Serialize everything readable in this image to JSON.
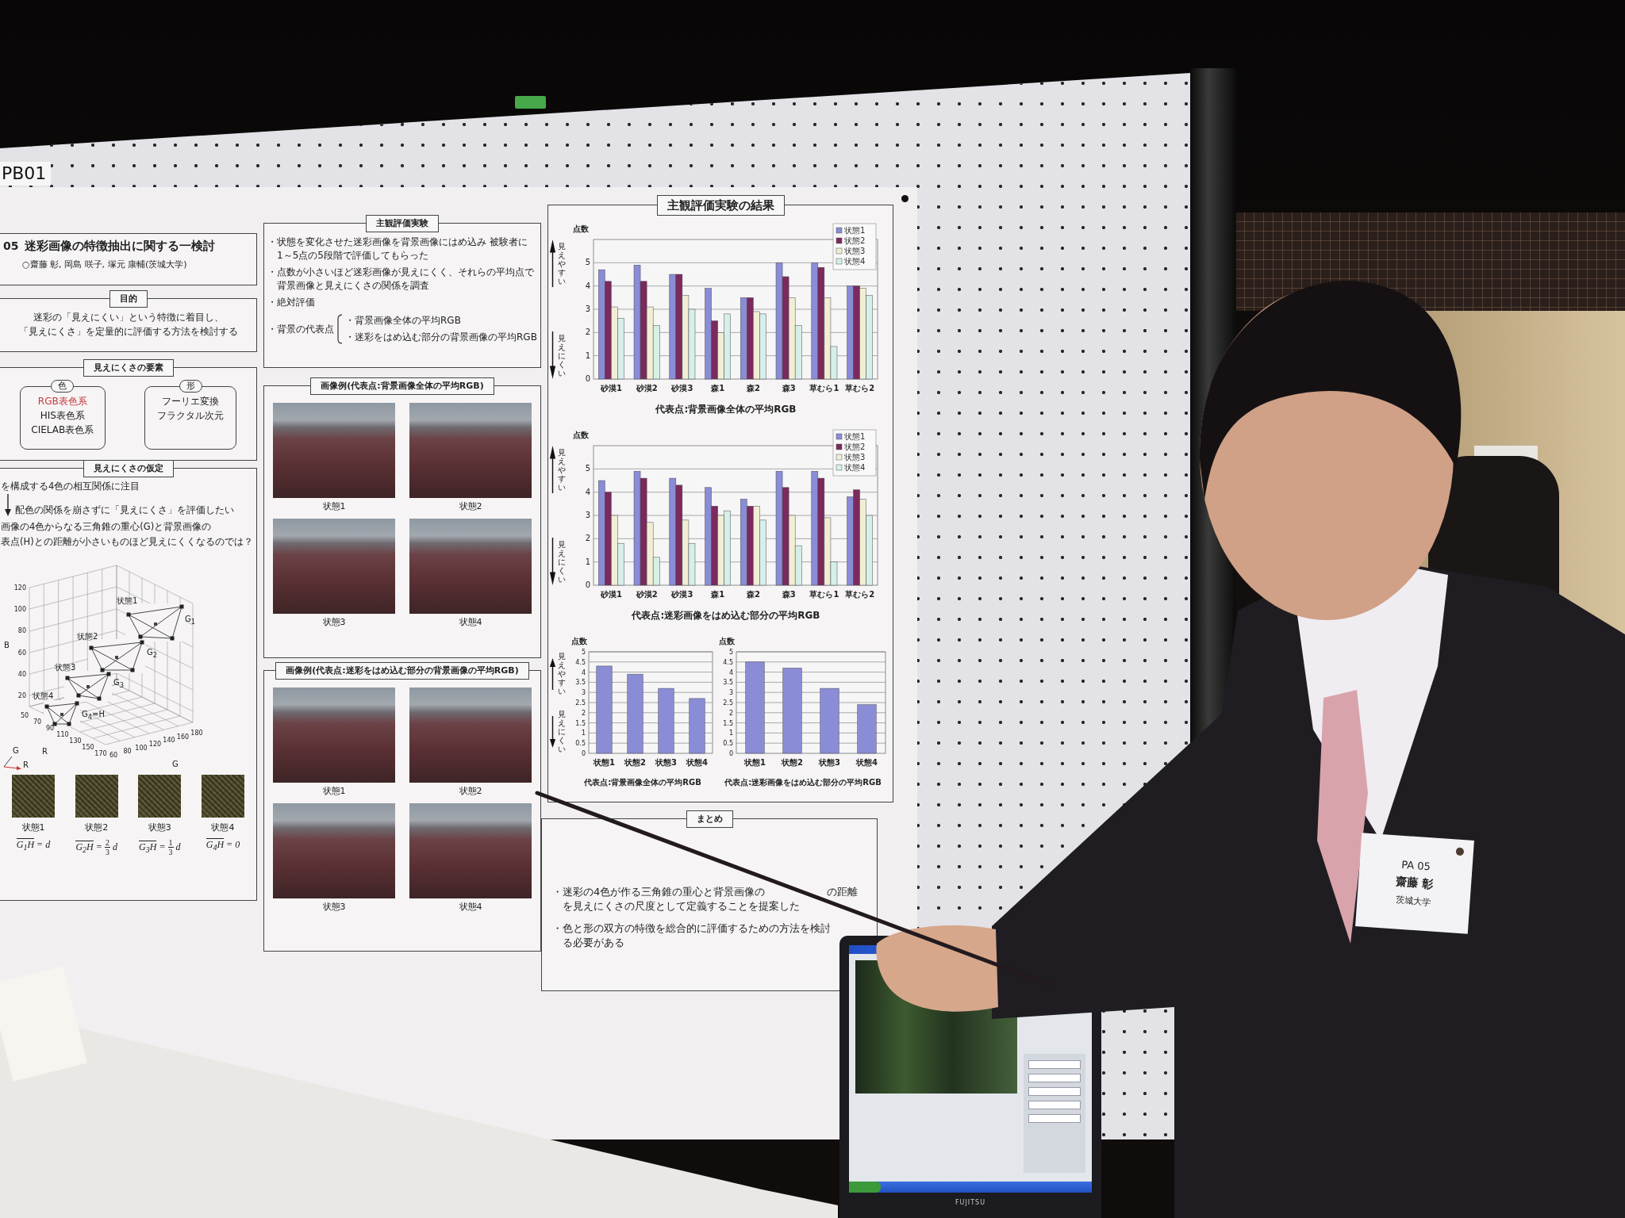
{
  "board_label": "PB01",
  "poster": {
    "title": {
      "number": "05",
      "text": "迷彩画像の特徴抽出に関する一検討",
      "authors": "○齋藤 彰, 岡島 咲子, 塚元 康輔(茨城大学)"
    },
    "purpose": {
      "heading": "目的",
      "text_lines": [
        "迷彩の「見えにくい」という特徴に着目し、",
        "「見えにくさ」を定量的に評価する方法を検討する"
      ]
    },
    "factors": {
      "heading": "見えにくさの要素",
      "groups": [
        {
          "heading": "色",
          "items": [
            {
              "text": "RGB表色系",
              "highlighted": true
            },
            {
              "text": "HIS表色系",
              "highlighted": false
            },
            {
              "text": "CIELAB表色系",
              "highlighted": false
            }
          ]
        },
        {
          "heading": "形",
          "items": [
            {
              "text": "フーリエ変換",
              "highlighted": false
            },
            {
              "text": "フラクタル次元",
              "highlighted": false
            }
          ]
        }
      ]
    },
    "hypothesis": {
      "heading": "見えにくさの仮定",
      "statements": [
        {
          "kind": "text",
          "text": "を構成する4色の相互関係に注目"
        },
        {
          "kind": "arrow",
          "text": "配色の関係を崩さずに「見えにくさ」を評価したい"
        },
        {
          "kind": "text",
          "text": "画像の4色からなる三角錐の重心(G)と背景画像の"
        },
        {
          "kind": "text",
          "text": "表点(H)との距離が小さいものほど見えにくくなるのでは？"
        }
      ],
      "plot": {
        "b_axis": "B",
        "r_axis": "R",
        "g_axis": "G",
        "b_ticks": [
          "120",
          "100",
          "80",
          "60",
          "40",
          "20"
        ],
        "r_ticks": [
          "50",
          "70",
          "90",
          "110",
          "130",
          "150",
          "170"
        ],
        "g_ticks": [
          "60",
          "80",
          "100",
          "120",
          "140",
          "160",
          "180"
        ],
        "groups": [
          {
            "label": "状態1",
            "centroid": "G$_{1}$"
          },
          {
            "label": "状態2",
            "centroid": "G$_{2}$"
          },
          {
            "label": "状態3",
            "centroid": "G$_{3}$"
          },
          {
            "label": "状態4",
            "centroid": "G$_{4}$=H"
          }
        ],
        "orientation": [
          "G",
          "R"
        ]
      },
      "states": [
        {
          "label": "状態1",
          "formula": [
            {
              "kind": "over",
              "text": "G$_{1}$H"
            },
            {
              "kind": "text",
              "text": "= d"
            }
          ]
        },
        {
          "label": "状態2",
          "formula": [
            {
              "kind": "over",
              "text": "G$_{2}$H"
            },
            {
              "kind": "text",
              "text": "="
            },
            {
              "kind": "frac",
              "num": "2",
              "den": "3"
            },
            {
              "kind": "text",
              "text": "d"
            }
          ]
        },
        {
          "label": "状態3",
          "formula": [
            {
              "kind": "over",
              "text": "G$_{3}$H"
            },
            {
              "kind": "text",
              "text": "="
            },
            {
              "kind": "frac",
              "num": "1",
              "den": "3"
            },
            {
              "kind": "text",
              "text": "d"
            }
          ]
        },
        {
          "label": "状態4",
          "formula": [
            {
              "kind": "over",
              "text": "G$_{4}$H"
            },
            {
              "kind": "text",
              "text": "= 0"
            }
          ]
        }
      ]
    },
    "experiment": {
      "heading": "主観評価実験",
      "bullets": [
        {
          "lines": [
            "・状態を変化させた迷彩画像を背景画像にはめ込み 被験者に",
            "1～5点の5段階で評価してもらった"
          ]
        },
        {
          "lines": [
            "・点数が小さいほど迷彩画像が見えにくく、それらの平均点で",
            "背景画像と見えにくさの関係を調査"
          ]
        },
        {
          "lines": [
            "・絶対評価"
          ]
        }
      ],
      "representative": {
        "label": "・背景の代表点",
        "options": [
          "・背景画像全体の平均RGB",
          "・迷彩をはめ込む部分の背景画像の平均RGB"
        ]
      }
    },
    "examples": [
      {
        "heading": "画像例(代表点:背景画像全体の平均RGB)",
        "photos": [
          {
            "caption": "状態1"
          },
          {
            "caption": "状態2"
          },
          {
            "caption": "状態3"
          },
          {
            "caption": "状態4"
          }
        ]
      },
      {
        "heading": "画像例(代表点:迷彩をはめ込む部分の背景画像の平均RGB)",
        "photos": [
          {
            "caption": "状態1"
          },
          {
            "caption": "状態2"
          },
          {
            "caption": "状態3"
          },
          {
            "caption": "状態4"
          }
        ]
      }
    ],
    "results": {
      "heading": "主観評価実験の結果",
      "charts": [
        {
          "hint": {
            "up": "見えやすい",
            "down": "見えにくい"
          },
          "chart_data": {
            "type": "bar",
            "ylabel": "点数",
            "xlabel": "代表点:背景画像全体の平均RGB",
            "categories": [
              "砂漠1",
              "砂漠2",
              "砂漠3",
              "森1",
              "森2",
              "森3",
              "草むら1",
              "草むら2"
            ],
            "series": [
              {
                "name": "状態1",
                "color": "#8a8cd6",
                "values": [
                  4.7,
                  4.9,
                  4.5,
                  3.9,
                  3.5,
                  5.0,
                  5.0,
                  4.0
                ]
              },
              {
                "name": "状態2",
                "color": "#7a2a5c",
                "values": [
                  4.2,
                  4.2,
                  4.5,
                  2.5,
                  3.5,
                  4.4,
                  4.8,
                  4.0
                ]
              },
              {
                "name": "状態3",
                "color": "#f1eed4",
                "values": [
                  3.1,
                  3.1,
                  3.6,
                  2.0,
                  2.9,
                  3.5,
                  3.5,
                  3.9
                ]
              },
              {
                "name": "状態4",
                "color": "#d6efe9",
                "values": [
                  2.6,
                  2.3,
                  3.0,
                  2.8,
                  2.8,
                  2.3,
                  1.4,
                  3.6
                ]
              }
            ],
            "ylim": [
              0,
              6
            ],
            "yticks": [
              0,
              1,
              2,
              3,
              4,
              5
            ],
            "grid": true,
            "legend": "upper right"
          }
        },
        {
          "hint": {
            "up": "見えやすい",
            "down": "見えにくい"
          },
          "chart_data": {
            "type": "bar",
            "ylabel": "点数",
            "xlabel": "代表点:迷彩画像をはめ込む部分の平均RGB",
            "categories": [
              "砂漠1",
              "砂漠2",
              "砂漠3",
              "森1",
              "森2",
              "森3",
              "草むら1",
              "草むら2"
            ],
            "series": [
              {
                "name": "状態1",
                "color": "#8a8cd6",
                "values": [
                  4.5,
                  4.9,
                  4.6,
                  4.2,
                  3.7,
                  4.9,
                  4.9,
                  3.8
                ]
              },
              {
                "name": "状態2",
                "color": "#7a2a5c",
                "values": [
                  4.0,
                  4.6,
                  4.3,
                  3.4,
                  3.4,
                  4.2,
                  4.6,
                  4.1
                ]
              },
              {
                "name": "状態3",
                "color": "#f1eed4",
                "values": [
                  3.0,
                  2.7,
                  2.8,
                  3.0,
                  3.4,
                  3.0,
                  2.9,
                  3.7
                ]
              },
              {
                "name": "状態4",
                "color": "#d6efe9",
                "values": [
                  1.8,
                  1.2,
                  1.8,
                  3.2,
                  2.8,
                  1.7,
                  1.0,
                  3.0
                ]
              }
            ],
            "ylim": [
              0,
              6
            ],
            "yticks": [
              0,
              1,
              2,
              3,
              4,
              5
            ],
            "grid": true,
            "legend": "upper right"
          }
        },
        {
          "hint": {
            "up": "見えやすい",
            "down": "見えにくい"
          },
          "chart_data": {
            "type": "bar",
            "ylabel": "点数",
            "xlabel": "代表点:背景画像全体の平均RGB",
            "categories": [
              "状態1",
              "状態2",
              "状態3",
              "状態4"
            ],
            "values": [
              4.3,
              3.9,
              3.2,
              2.7
            ],
            "ylim": [
              0,
              5
            ],
            "yticks": [
              0,
              0.5,
              1,
              1.5,
              2,
              2.5,
              3,
              3.5,
              4,
              4.5,
              5
            ],
            "grid": true
          }
        },
        {
          "chart_data": {
            "type": "bar",
            "ylabel": "点数",
            "xlabel": "代表点:迷彩画像をはめ込む部分の平均RGB",
            "categories": [
              "状態1",
              "状態2",
              "状態3",
              "状態4"
            ],
            "values": [
              4.5,
              4.2,
              3.2,
              2.4
            ],
            "ylim": [
              0,
              5
            ],
            "yticks": [
              0,
              0.5,
              1,
              1.5,
              2,
              2.5,
              3,
              3.5,
              4,
              4.5,
              5
            ],
            "grid": true
          }
        }
      ]
    },
    "summary": {
      "heading": "まとめ",
      "bullets": [
        {
          "kind": "covered",
          "lines": [
            [
              "・迷彩の4色が作る三角錐の重心と背景画像の",
              "の距離"
            ],
            [
              "を見えにくさの尺度として定義することを提案した"
            ]
          ]
        },
        {
          "kind": "plain",
          "lines": [
            "・色と形の双方の特徴を総合的に評価するための方法を検討",
            "る必要がある"
          ]
        }
      ]
    }
  },
  "laptop": {
    "brand": "FUJITSU"
  },
  "name_card": {
    "code": "PA 05",
    "name": "齋藤 彰",
    "affiliation": "茨城大学"
  }
}
